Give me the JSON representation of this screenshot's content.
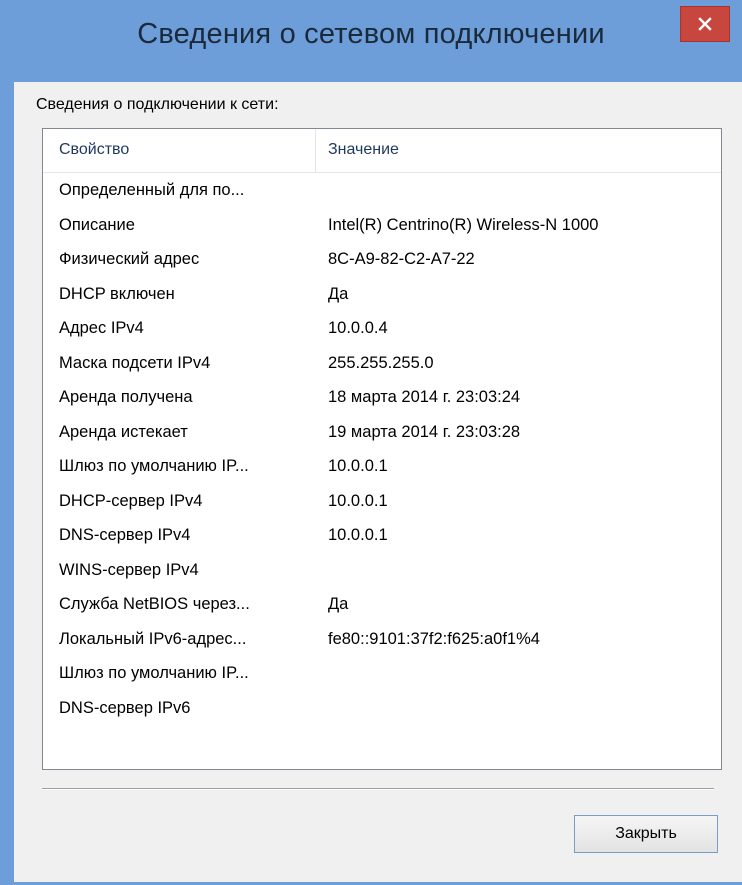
{
  "window": {
    "title": "Сведения о сетевом подключении"
  },
  "section_label": "Сведения о подключении к сети:",
  "columns": {
    "property": "Свойство",
    "value": "Значение"
  },
  "rows": [
    {
      "property": "Определенный для по...",
      "value": ""
    },
    {
      "property": "Описание",
      "value": "Intel(R) Centrino(R) Wireless-N  1000"
    },
    {
      "property": "Физический адрес",
      "value": "8C-A9-82-C2-A7-22"
    },
    {
      "property": "DHCP включен",
      "value": "Да"
    },
    {
      "property": "Адрес IPv4",
      "value": "10.0.0.4"
    },
    {
      "property": "Маска подсети IPv4",
      "value": "255.255.255.0"
    },
    {
      "property": "Аренда получена",
      "value": "18 марта 2014 г. 23:03:24"
    },
    {
      "property": "Аренда истекает",
      "value": "19 марта 2014 г. 23:03:28"
    },
    {
      "property": "Шлюз по умолчанию IP...",
      "value": "10.0.0.1"
    },
    {
      "property": "DHCP-сервер IPv4",
      "value": "10.0.0.1"
    },
    {
      "property": "DNS-сервер IPv4",
      "value": "10.0.0.1"
    },
    {
      "property": "WINS-сервер IPv4",
      "value": ""
    },
    {
      "property": "Служба NetBIOS через...",
      "value": "Да"
    },
    {
      "property": "Локальный IPv6-адрес...",
      "value": "fe80::9101:37f2:f625:a0f1%4"
    },
    {
      "property": "Шлюз по умолчанию IP...",
      "value": ""
    },
    {
      "property": "DNS-сервер IPv6",
      "value": ""
    }
  ],
  "buttons": {
    "close": "Закрыть"
  },
  "icons": {
    "close": "close-icon"
  },
  "colors": {
    "titlebar": "#6e9ed9",
    "close_button": "#c7463d"
  }
}
